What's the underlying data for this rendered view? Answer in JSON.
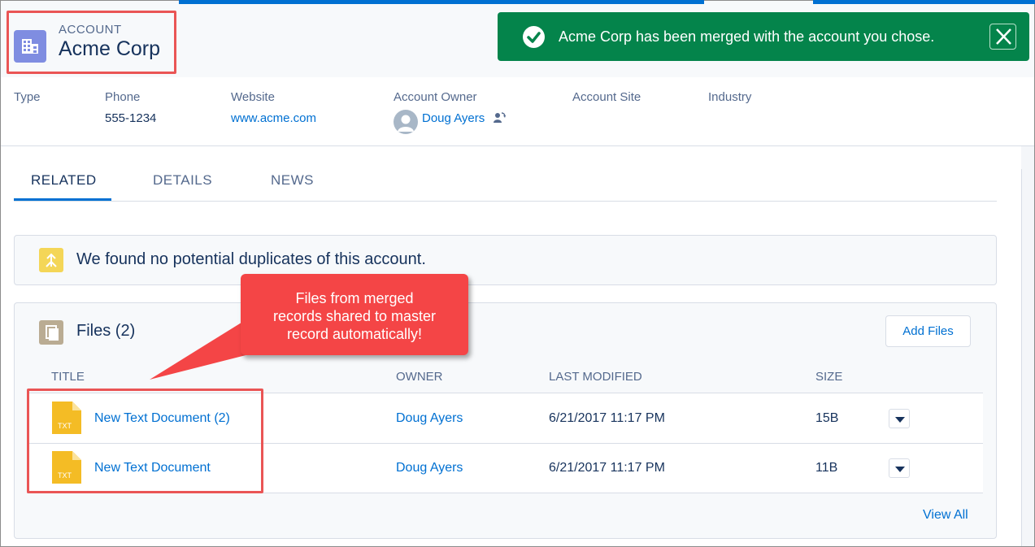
{
  "header": {
    "object_type": "ACCOUNT",
    "record_name": "Acme Corp"
  },
  "toast": {
    "message": "Acme Corp has been merged with the account you chose.",
    "color": "#04844b"
  },
  "highlights": {
    "type_label": "Type",
    "phone_label": "Phone",
    "phone_value": "555-1234",
    "website_label": "Website",
    "website_value": "www.acme.com",
    "owner_label": "Account Owner",
    "owner_value": "Doug Ayers",
    "site_label": "Account Site",
    "industry_label": "Industry"
  },
  "tabs": [
    {
      "label": "RELATED",
      "active": true
    },
    {
      "label": "DETAILS",
      "active": false
    },
    {
      "label": "NEWS",
      "active": false
    }
  ],
  "duplicates": {
    "message": "We found no potential duplicates of this account."
  },
  "files": {
    "title": "Files (2)",
    "add_label": "Add Files",
    "columns": [
      "TITLE",
      "OWNER",
      "LAST MODIFIED",
      "SIZE"
    ],
    "rows": [
      {
        "title": "New Text Document (2)",
        "owner": "Doug Ayers",
        "modified": "6/21/2017 11:17 PM",
        "size": "15B",
        "icon_text": "TXT"
      },
      {
        "title": "New Text Document",
        "owner": "Doug Ayers",
        "modified": "6/21/2017 11:17 PM",
        "size": "11B",
        "icon_text": "TXT"
      }
    ],
    "view_all": "View All"
  },
  "callout": {
    "lines": [
      "Files from merged",
      "records shared to master",
      "record automatically!"
    ],
    "color": "#f44546"
  },
  "colors": {
    "accent": "#0070d2",
    "annotation_box": "#ea5555",
    "account_icon": "#7f8de1",
    "duplicate_icon": "#f4d657",
    "files_icon": "#baac93",
    "file_icon": "#f4bc25"
  }
}
